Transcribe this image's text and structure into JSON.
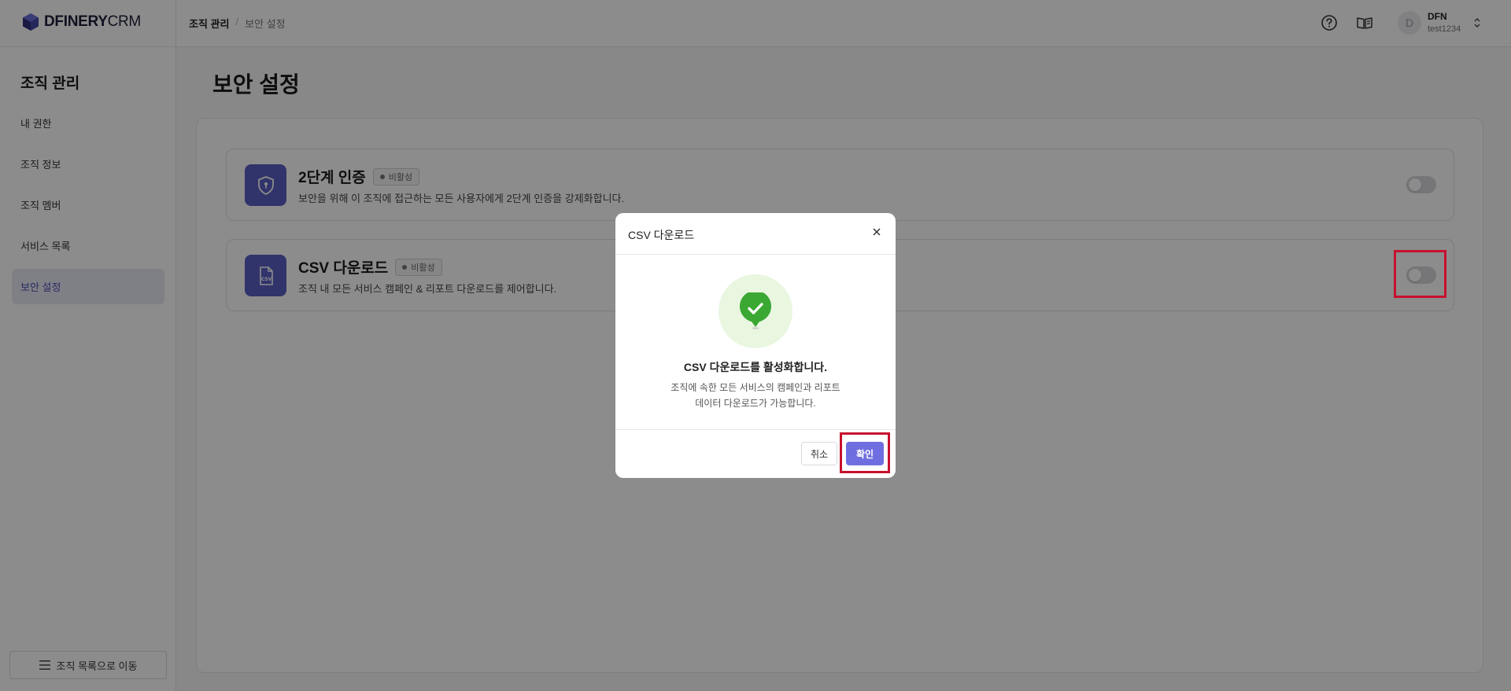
{
  "app": {
    "logo_bold": "DFINERY",
    "logo_light": "CRM"
  },
  "header": {
    "breadcrumb": [
      "조직 관리",
      "보안 설정"
    ],
    "breadcrumb_separator": "/",
    "user": {
      "avatar_initial": "D",
      "name": "DFN",
      "id": "test1234"
    },
    "icons": [
      "help-circle-icon",
      "book-open-icon",
      "chevron-updown-icon"
    ]
  },
  "sidebar": {
    "title": "조직 관리",
    "items": [
      {
        "label": "내 권한",
        "active": false
      },
      {
        "label": "조직 정보",
        "active": false
      },
      {
        "label": "조직 멤버",
        "active": false
      },
      {
        "label": "서비스 목록",
        "active": false
      },
      {
        "label": "보안 설정",
        "active": true
      }
    ],
    "footer_button": "조직 목록으로 이동"
  },
  "main": {
    "title": "보안 설정",
    "cards": [
      {
        "icon": "shield-icon",
        "title": "2단계 인증",
        "badge": "비활성",
        "description": "보안을 위해 이 조직에 접근하는 모든 사용자에게 2단계 인증을 강제화합니다.",
        "enabled": false
      },
      {
        "icon": "csv-file-icon",
        "title": "CSV 다운로드",
        "badge": "비활성",
        "description": "조직 내 모든 서비스 캠페인 & 리포트 다운로드를 제어합니다.",
        "enabled": false
      }
    ]
  },
  "modal": {
    "title": "CSV 다운로드",
    "icon": "check-badge-icon",
    "heading": "CSV 다운로드를 활성화합니다.",
    "description_line1": "조직에 속한 모든 서비스의 캠페인과 리포트",
    "description_line2": "데이터 다운로드가 가능합니다.",
    "cancel_label": "취소",
    "confirm_label": "확인"
  },
  "colors": {
    "accent": "#5a5fc4",
    "confirm": "#6f6ee0",
    "highlight": "#c8102e",
    "success": "#3aa832"
  }
}
